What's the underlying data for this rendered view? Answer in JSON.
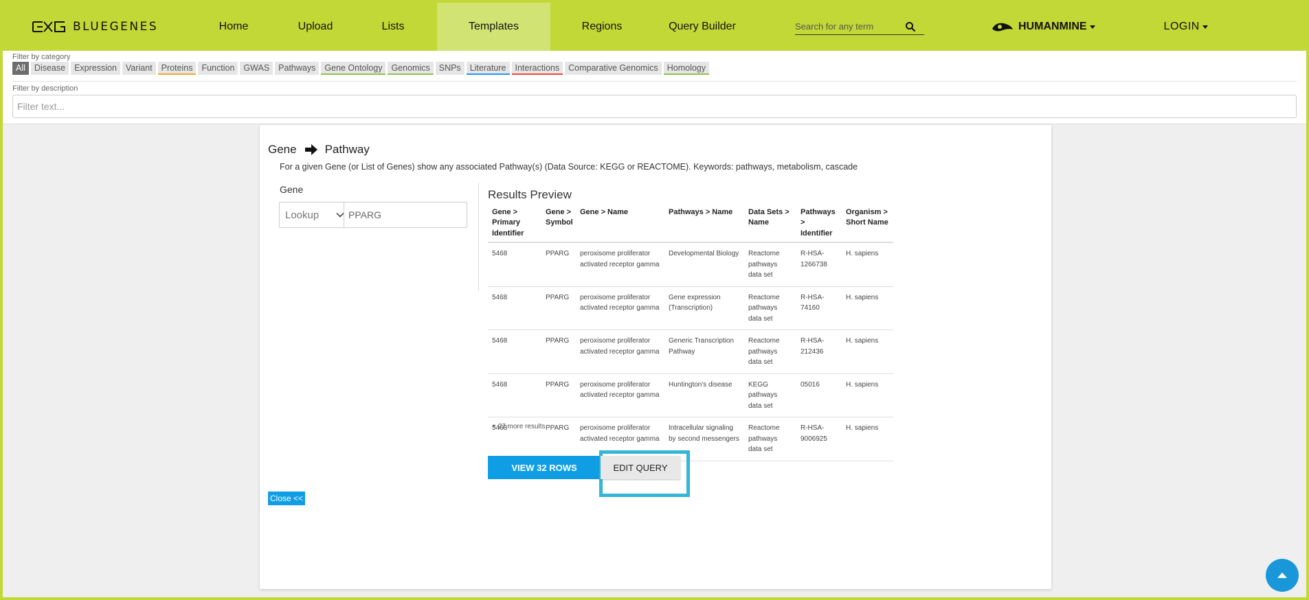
{
  "brand": {
    "name": "BLUEGENES"
  },
  "nav": {
    "items": [
      {
        "label": "Home"
      },
      {
        "label": "Upload"
      },
      {
        "label": "Lists"
      },
      {
        "label": "Templates"
      },
      {
        "label": "Regions"
      },
      {
        "label": "Query Builder"
      }
    ],
    "search_placeholder": "Search for any term",
    "mine_label": "HUMANMINE",
    "login_label": "LOGIN"
  },
  "filters": {
    "category_label": "Filter by category",
    "categories": [
      {
        "label": "All",
        "underline": ""
      },
      {
        "label": "Disease",
        "underline": ""
      },
      {
        "label": "Expression",
        "underline": ""
      },
      {
        "label": "Variant",
        "underline": ""
      },
      {
        "label": "Proteins",
        "underline": "#f5a623"
      },
      {
        "label": "Function",
        "underline": ""
      },
      {
        "label": "GWAS",
        "underline": ""
      },
      {
        "label": "Pathways",
        "underline": ""
      },
      {
        "label": "Gene Ontology",
        "underline": "#8bc34a"
      },
      {
        "label": "Genomics",
        "underline": "#8bc34a"
      },
      {
        "label": "SNPs",
        "underline": ""
      },
      {
        "label": "Literature",
        "underline": "#2196f3"
      },
      {
        "label": "Interactions",
        "underline": "#f44336"
      },
      {
        "label": "Comparative Genomics",
        "underline": ""
      },
      {
        "label": "Homology",
        "underline": "#8bc34a"
      }
    ],
    "description_label": "Filter by description",
    "description_placeholder": "Filter text..."
  },
  "template": {
    "from": "Gene",
    "to": "Pathway",
    "description": "For a given Gene (or List of Genes) show any associated Pathway(s) (Data Source: KEGG or REACTOME). Keywords: pathways, metabolism, cascade",
    "constraint_label": "Gene",
    "lookup_label": "Lookup",
    "gene_value": "PPARG",
    "results_title": "Results Preview",
    "columns": [
      "Gene > Primary Identifier",
      "Gene > Symbol",
      "Gene > Name",
      "Pathways > Name",
      "Data Sets > Name",
      "Pathways > Identifier",
      "Organism > Short Name"
    ],
    "rows": [
      [
        "5468",
        "PPARG",
        "peroxisome proliferator activated receptor gamma",
        "Developmental Biology",
        "Reactome pathways data set",
        "R-HSA-1266738",
        "H. sapiens"
      ],
      [
        "5468",
        "PPARG",
        "peroxisome proliferator activated receptor gamma",
        "Gene expression (Transcription)",
        "Reactome pathways data set",
        "R-HSA-74160",
        "H. sapiens"
      ],
      [
        "5468",
        "PPARG",
        "peroxisome proliferator activated receptor gamma",
        "Generic Transcription Pathway",
        "Reactome pathways data set",
        "R-HSA-212436",
        "H. sapiens"
      ],
      [
        "5468",
        "PPARG",
        "peroxisome proliferator activated receptor gamma",
        "Huntington's disease",
        "KEGG pathways data set",
        "05016",
        "H. sapiens"
      ],
      [
        "5468",
        "PPARG",
        "peroxisome proliferator activated receptor gamma",
        "Intracellular signaling by second messengers",
        "Reactome pathways data set",
        "R-HSA-9006925",
        "H. sapiens"
      ]
    ],
    "more_results": "+ 27 more results",
    "view_rows_label": "VIEW 32 ROWS",
    "edit_query_label": "EDIT QUERY",
    "close_label": "Close <<"
  },
  "colors": {
    "brand_green": "#c2d836",
    "active_tab": "#d1e473",
    "primary_blue": "#0f9ee4",
    "highlight_cyan": "#35b6d6"
  }
}
